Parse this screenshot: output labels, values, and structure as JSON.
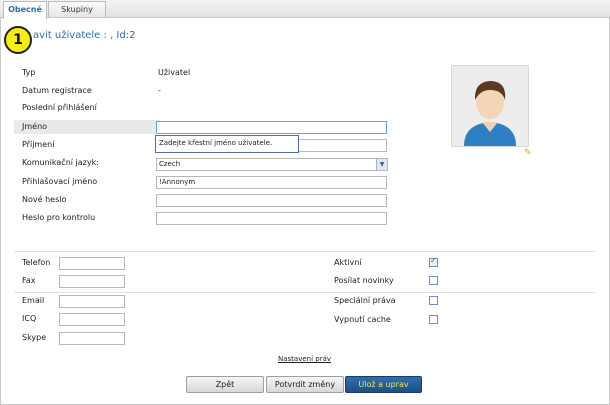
{
  "tabs": [
    {
      "label": "Obecné",
      "active": true
    },
    {
      "label": "Skupiny",
      "active": false
    }
  ],
  "heading": {
    "text": "avit uživatele : , Id:2"
  },
  "badge": {
    "text": "1"
  },
  "info": [
    {
      "label": "Typ",
      "value": "Uživatel"
    },
    {
      "label": "Datum registrace",
      "value": "-"
    },
    {
      "label": "Poslední přihlášení",
      "value": ""
    }
  ],
  "fields": {
    "jmeno": {
      "label": "Jméno",
      "value": ""
    },
    "prijmeni": {
      "label": "Příjmení",
      "value": ""
    },
    "jazyk": {
      "label": "Komunikační jazyk:",
      "value": "Czech"
    },
    "login": {
      "label": "Přihlašovací jméno",
      "value": "!Annonym"
    },
    "heslo": {
      "label": "Nové heslo",
      "value": ""
    },
    "heslo2": {
      "label": "Heslo pro kontrolu",
      "value": ""
    }
  },
  "tooltip": {
    "text": "Zadejte křestní jméno uživatele."
  },
  "contacts": [
    {
      "label": "Telefon",
      "value": ""
    },
    {
      "label": "Fax",
      "value": ""
    },
    {
      "label": "Email",
      "value": ""
    },
    {
      "label": "ICQ",
      "value": ""
    },
    {
      "label": "Skype",
      "value": ""
    }
  ],
  "options": [
    {
      "label": "Aktivní",
      "checked": true
    },
    {
      "label": "Posílat novinky",
      "checked": false
    },
    {
      "label": "Speciální práva",
      "checked": false
    },
    {
      "label": "Vypnutí cache",
      "checked": false
    }
  ],
  "links": {
    "permissions": "Nastavení práv"
  },
  "buttons": {
    "back": "Zpět",
    "confirm": "Potvrdit změny",
    "save": "Ulož a uprav"
  },
  "colors": {
    "accent": "#2a6fb0",
    "primary_button": "#1d4f86",
    "primary_text": "#f6e34a",
    "badge": "#f5ee11"
  }
}
